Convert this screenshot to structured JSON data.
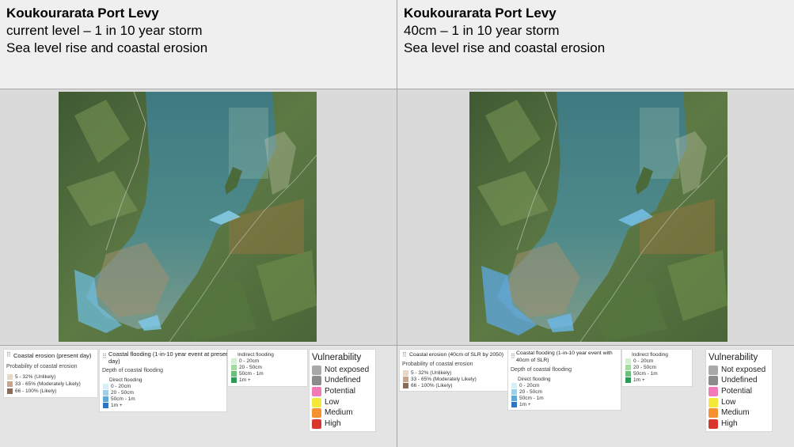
{
  "panels": [
    {
      "title": "Koukourarata Port Levy",
      "scenario": "current level – 1 in 10 year storm",
      "subject": "Sea level rise and coastal erosion",
      "erosion_legend": {
        "title": "Coastal erosion (present day)",
        "subtitle": "Probability of coastal erosion",
        "items": [
          "5 - 32% (Unlikely)",
          "33 - 65% (Moderately Likely)",
          "66 - 100% (Likely)"
        ]
      },
      "flooding_legend": {
        "title_line1": "Coastal flooding (1-in-10 year event at present",
        "title_line2": "day)",
        "subtitle": "Depth of coastal flooding",
        "direct_title": "Direct flooding",
        "direct_items": [
          "0 - 20cm",
          "20 - 50cm",
          "50cm - 1m",
          "1m +"
        ],
        "indirect_title": "Indirect flooding",
        "indirect_items": [
          "0 - 20cm",
          "20 - 50cm",
          "50cm - 1m",
          "1m +"
        ]
      }
    },
    {
      "title": "Koukourarata Port Levy",
      "scenario": "40cm – 1 in 10 year storm",
      "subject": "Sea level rise and coastal erosion",
      "erosion_legend": {
        "title": "Coastal erosion (40cm of SLR by 2050)",
        "subtitle": "Probability of coastal erosion",
        "items": [
          "5 - 32% (Unlikely)",
          "33 - 65% (Moderately Likely)",
          "66 - 100% (Likely)"
        ]
      },
      "flooding_legend": {
        "title_line1": "Coastal flooding (1-in-10 year event with",
        "title_line2": "40cm of SLR)",
        "subtitle": "Depth of coastal flooding",
        "direct_title": "Direct flooding",
        "direct_items": [
          "0 - 20cm",
          "20 - 50cm",
          "50cm - 1m",
          "1m +"
        ],
        "indirect_title": "Indirect flooding",
        "indirect_items": [
          "0 - 20cm",
          "20 - 50cm",
          "50cm - 1m",
          "1m +"
        ]
      }
    }
  ],
  "vulnerability": {
    "title": "Vulnerability",
    "items": [
      {
        "label": "Not exposed",
        "color": "#a9a9a9"
      },
      {
        "label": "Undefined",
        "color": "#8c8c8c"
      },
      {
        "label": "Potential",
        "color": "#f27ab8"
      },
      {
        "label": "Low",
        "color": "#f5e83a"
      },
      {
        "label": "Medium",
        "color": "#f5922f"
      },
      {
        "label": "High",
        "color": "#d9362b"
      }
    ]
  },
  "colors": {
    "erosion": [
      "#e9d6c4",
      "#c9a488",
      "#8c6a55"
    ],
    "direct": [
      "#d8eef6",
      "#9fd0e6",
      "#5fa8d6",
      "#2f74c0"
    ],
    "indirect": [
      "#d4efd4",
      "#a4dba4",
      "#6cc07c",
      "#2f9a56"
    ]
  }
}
